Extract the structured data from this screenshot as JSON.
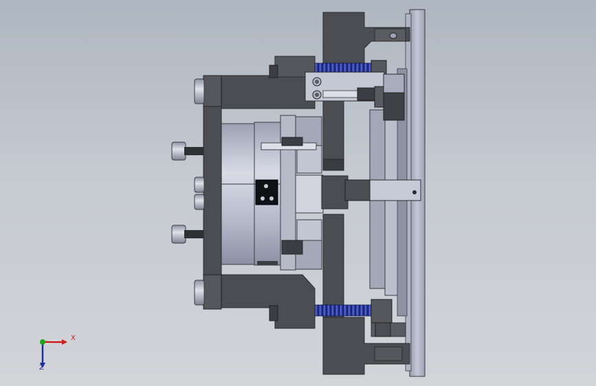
{
  "viewport": {
    "background_top": "#aeb6c1",
    "background_bottom": "#d2d4d8"
  },
  "model": {
    "colors": {
      "dark_part": "#4b4d52",
      "dark_part_edge": "#2a2b2e",
      "light_part": "#b9bdcc",
      "light_part_mid": "#9ea2b4",
      "plate": "#a6aabc",
      "spring": "#2f3fa8"
    }
  },
  "triad": {
    "x_label": "X",
    "z_label": "Z",
    "x_color": "#c81e1e",
    "y_color": "#1aa81a",
    "z_color": "#1e2e9a"
  }
}
